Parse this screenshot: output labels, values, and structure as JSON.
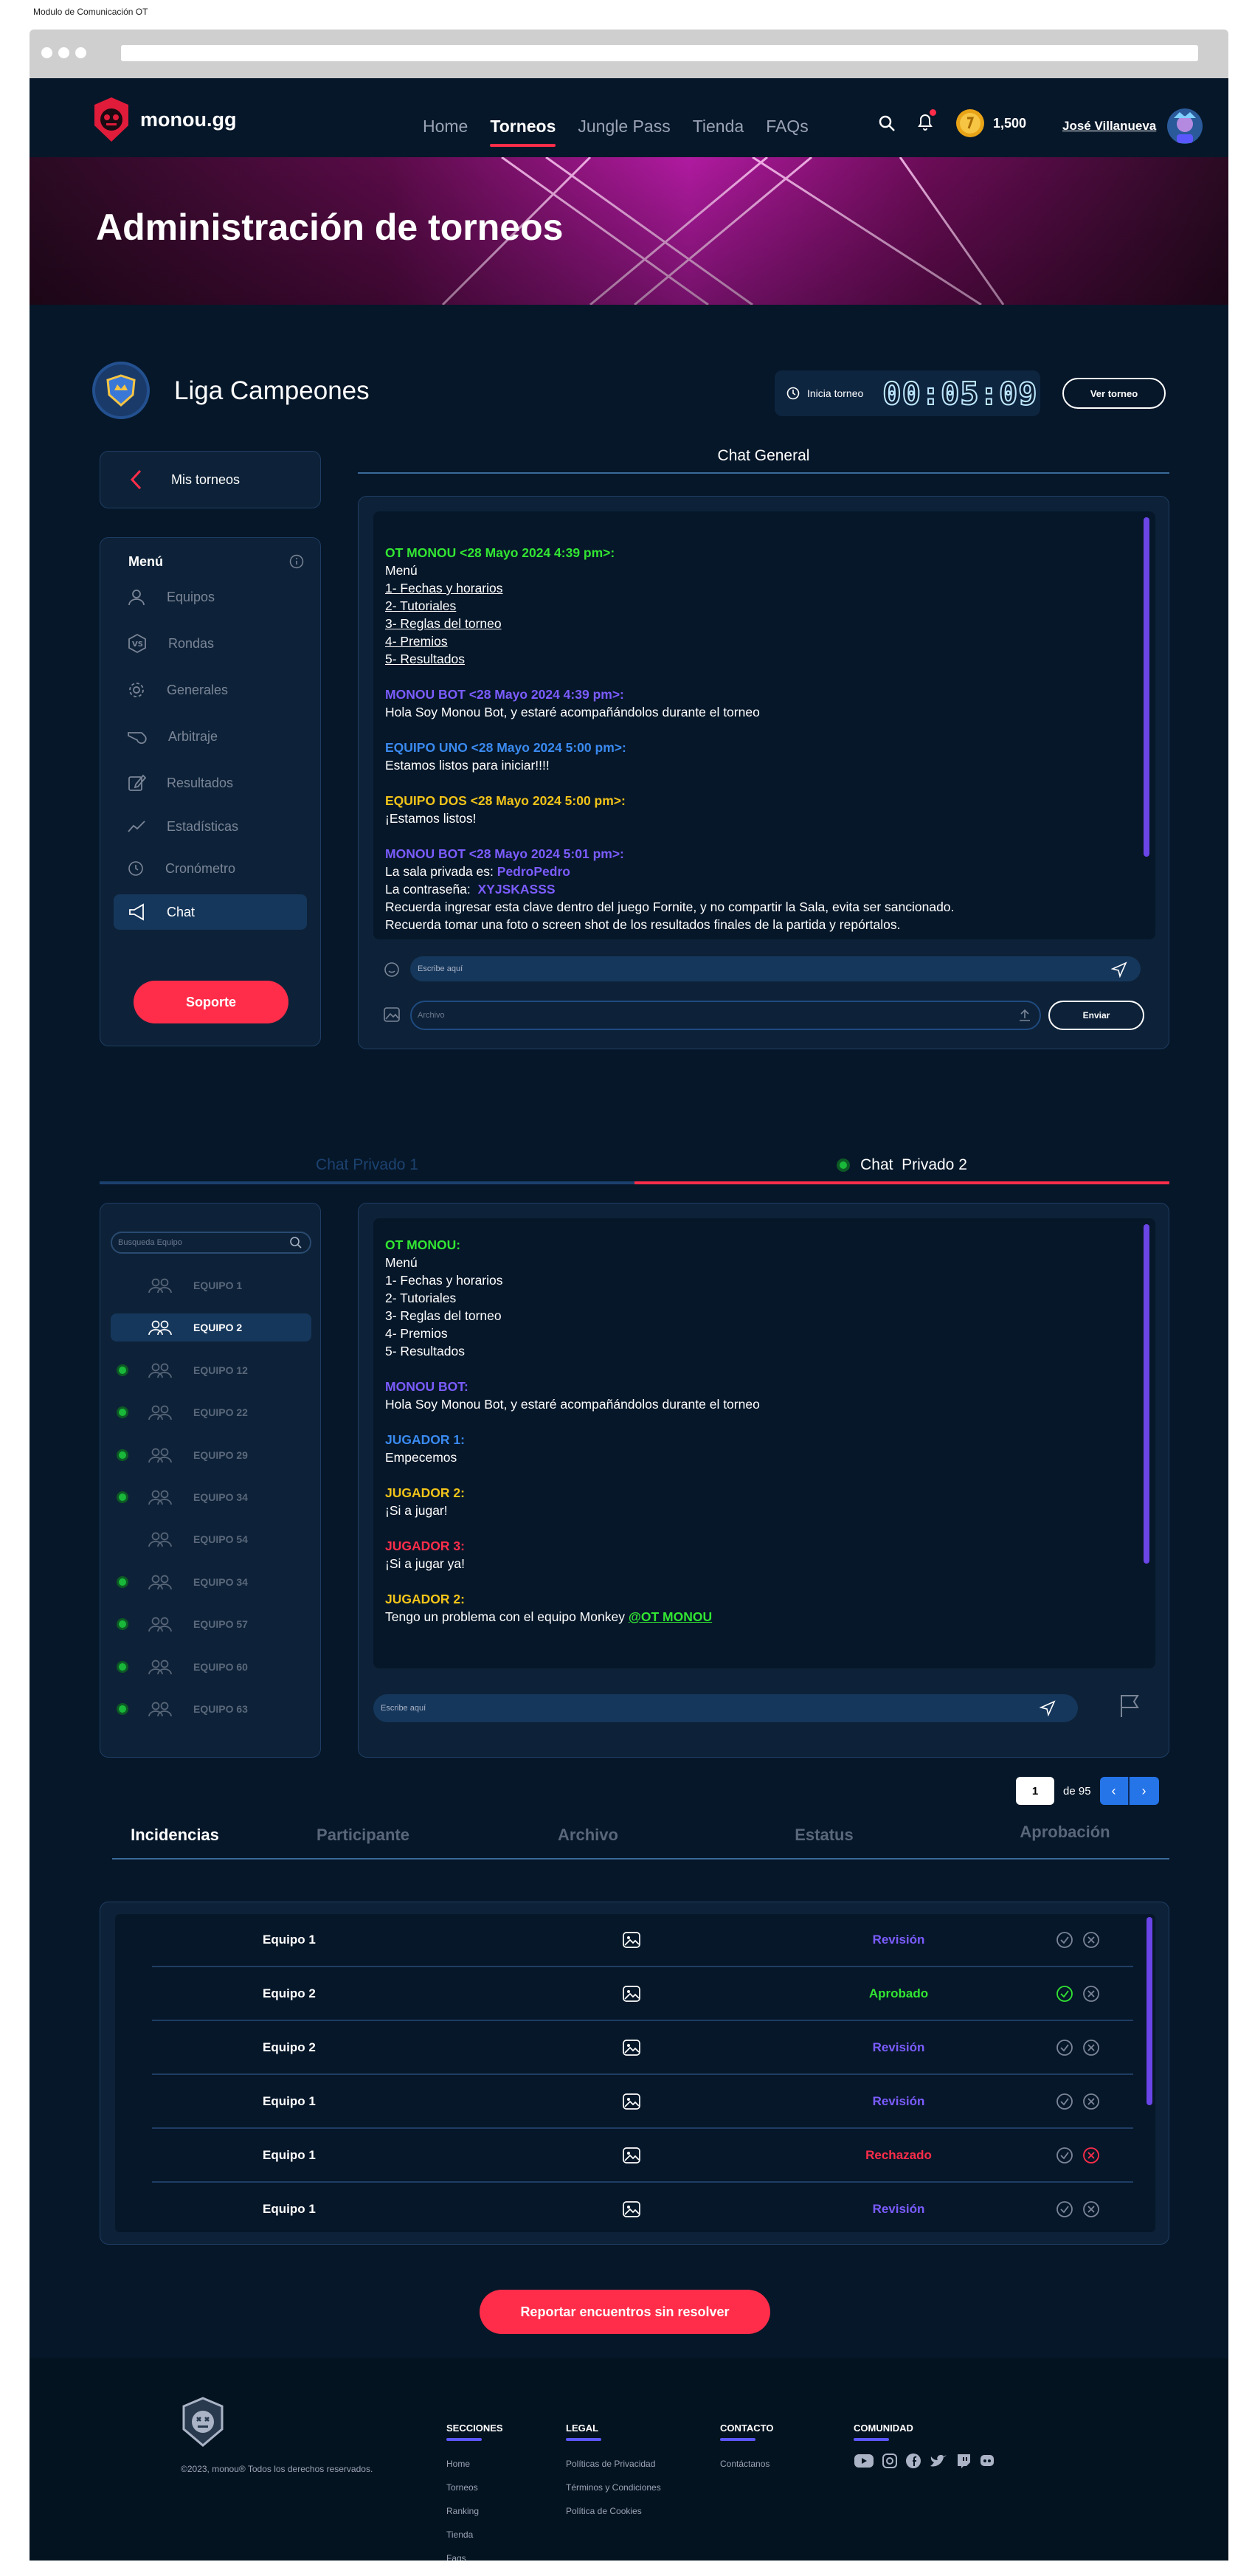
{
  "doc_title": "Modulo de Comunicación OT",
  "nav": {
    "brand": "monou.gg",
    "items": [
      {
        "label": "Home",
        "active": false
      },
      {
        "label": "Torneos",
        "active": true
      },
      {
        "label": "Jungle Pass",
        "active": false
      },
      {
        "label": "Tienda",
        "active": false
      },
      {
        "label": "FAQs",
        "active": false
      }
    ],
    "coins": "1,500",
    "user": "José Villanueva"
  },
  "banner": {
    "title": "Administración de torneos"
  },
  "tournament": {
    "name": "Liga Campeones",
    "timer_label": "Inicia torneo",
    "timer": "00:05:09",
    "view_button": "Ver torneo"
  },
  "sidebar": {
    "back": "Mis torneos",
    "menu_title": "Menú",
    "items": [
      {
        "label": "Equipos",
        "icon": "user-icon"
      },
      {
        "label": "Rondas",
        "icon": "vs-icon"
      },
      {
        "label": "Generales",
        "icon": "gear-icon"
      },
      {
        "label": "Arbitraje",
        "icon": "whistle-icon"
      },
      {
        "label": "Resultados",
        "icon": "edit-icon"
      },
      {
        "label": "Estadísticas",
        "icon": "trend-icon"
      },
      {
        "label": "Cronómetro",
        "icon": "clock-icon"
      },
      {
        "label": "Chat",
        "icon": "megaphone-icon",
        "active": true
      }
    ],
    "support": "Soporte"
  },
  "general_chat": {
    "title": "Chat General",
    "input_placeholder": "Escribe aquí",
    "file_placeholder": "Archivo",
    "send": "Enviar",
    "messages": [
      {
        "header": "OT MONOU <28 Mayo 2024 4:39 pm>:",
        "color": "#32e632",
        "lines": [
          "Menú",
          "1- Fechas y horarios",
          "2- Tutoriales",
          "3- Reglas del torneo",
          "4- Premios",
          "5- Resultados"
        ]
      },
      {
        "header": "MONOU BOT <28 Mayo 2024 4:39 pm>:",
        "color": "#7b5cff",
        "lines": [
          "Hola Soy Monou Bot, y estaré acompañándolos durante el torneo"
        ]
      },
      {
        "header": "EQUIPO UNO <28 Mayo 2024 5:00 pm>:",
        "color": "#3a8af0",
        "lines": [
          "Estamos listos para iniciar!!!!"
        ]
      },
      {
        "header": "EQUIPO DOS <28 Mayo 2024 5:00 pm>:",
        "color": "#f2c419",
        "lines": [
          "¡Estamos listos!"
        ]
      },
      {
        "header": "MONOU BOT <28 Mayo 2024 5:01 pm>:",
        "color": "#7b5cff",
        "lines": [
          "La sala privada es:",
          "La contraseña:",
          "Recuerda ingresar esta clave dentro del juego Fornite, y no compartir la Sala, evita ser sancionado.",
          "Recuerda tomar una foto o screen shot de los resultados finales de la partida y repórtalos."
        ],
        "room": "PedroPedro",
        "password": "XYJSKASSS"
      }
    ]
  },
  "private_tabs": [
    {
      "label": "Chat Privado 1",
      "active": false
    },
    {
      "label": "Chat  Privado 2",
      "active": true
    }
  ],
  "teams": {
    "search_placeholder": "Busqueda Equipo",
    "list": [
      {
        "name": "EQUIPO 1",
        "online": false
      },
      {
        "name": "EQUIPO 2",
        "online": false,
        "active": true
      },
      {
        "name": "EQUIPO 12",
        "online": true
      },
      {
        "name": "EQUIPO 22",
        "online": true
      },
      {
        "name": "EQUIPO 29",
        "online": true
      },
      {
        "name": "EQUIPO 34",
        "online": true
      },
      {
        "name": "EQUIPO 54",
        "online": false
      },
      {
        "name": "EQUIPO 34",
        "online": true
      },
      {
        "name": "EQUIPO 57",
        "online": true
      },
      {
        "name": "EQUIPO 60",
        "online": true
      },
      {
        "name": "EQUIPO 63",
        "online": true
      }
    ]
  },
  "private_chat": {
    "input_placeholder": "Escribe aquí",
    "messages": [
      {
        "header": "OT MONOU:",
        "color": "#32e632",
        "lines": [
          "Menú",
          "1- Fechas y horarios",
          "2- Tutoriales",
          "3- Reglas del torneo",
          "4- Premios",
          "5- Resultados"
        ]
      },
      {
        "header": "MONOU BOT:",
        "color": "#7b5cff",
        "lines": [
          "Hola Soy Monou Bot, y estaré acompañándolos durante el torneo"
        ]
      },
      {
        "header": "JUGADOR 1:",
        "color": "#3a8af0",
        "lines": [
          "Empecemos"
        ]
      },
      {
        "header": "JUGADOR 2:",
        "color": "#f2c419",
        "lines": [
          "¡Si a jugar!"
        ]
      },
      {
        "header": "JUGADOR 3:",
        "color": "#ff2d4a",
        "lines": [
          "¡Si a jugar ya!"
        ]
      },
      {
        "header": "JUGADOR 2:",
        "color": "#f2c419",
        "lines": [
          "Tengo un problema con el equipo Monkey"
        ],
        "mention": "@OT MONOU"
      }
    ]
  },
  "pagination": {
    "page": "1",
    "of": "de 95"
  },
  "incidents": {
    "headers": [
      "Incidencias",
      "Participante",
      "Archivo",
      "Estatus",
      "Aprobación"
    ],
    "rows": [
      {
        "team": "Equipo 1",
        "status": "Revisión",
        "color": "#7b5cff",
        "approved": false,
        "rejected": false
      },
      {
        "team": "Equipo 2",
        "status": "Aprobado",
        "color": "#32e632",
        "approved": true,
        "rejected": false
      },
      {
        "team": "Equipo 2",
        "status": "Revisión",
        "color": "#7b5cff",
        "approved": false,
        "rejected": false
      },
      {
        "team": "Equipo 1",
        "status": "Revisión",
        "color": "#7b5cff",
        "approved": false,
        "rejected": false
      },
      {
        "team": "Equipo 1",
        "status": "Rechazado",
        "color": "#ff2d4a",
        "approved": false,
        "rejected": true
      },
      {
        "team": "Equipo 1",
        "status": "Revisión",
        "color": "#7b5cff",
        "approved": false,
        "rejected": false
      }
    ],
    "report_button": "Reportar encuentros sin resolver"
  },
  "footer": {
    "copyright": "©2023, monou® Todos los derechos reservados.",
    "sections_title": "SECCIONES",
    "sections": [
      "Home",
      "Torneos",
      "Ranking",
      "Tienda",
      "Faqs"
    ],
    "legal_title": "LEGAL",
    "legal": [
      "Políticas de Privacidad",
      "Términos y Condiciones",
      "Política de Cookies"
    ],
    "contact_title": "CONTACTO",
    "contact": [
      "Contáctanos"
    ],
    "community_title": "COMUNIDAD"
  }
}
